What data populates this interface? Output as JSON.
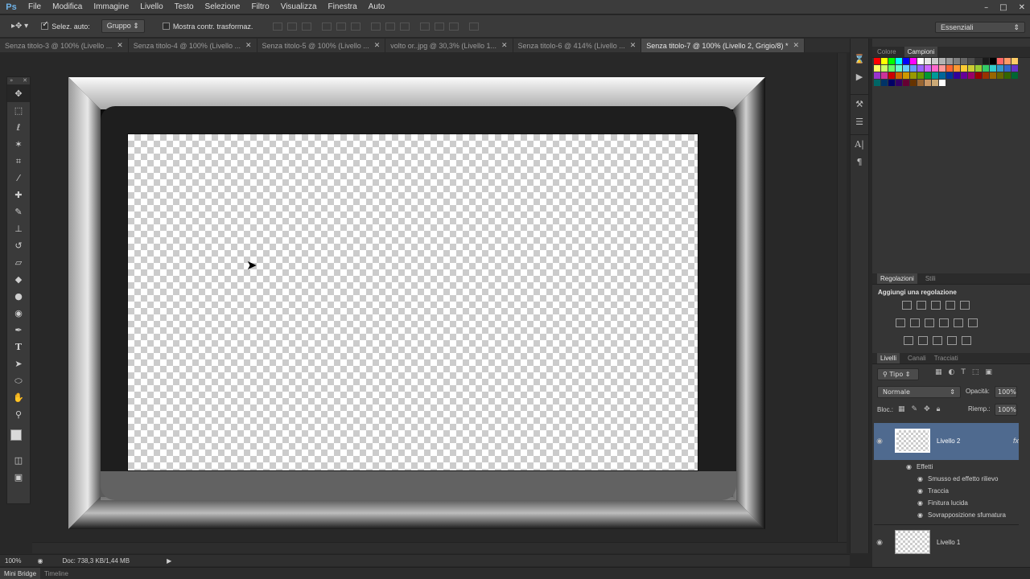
{
  "app": {
    "logo": "Ps"
  },
  "menu": [
    "File",
    "Modifica",
    "Immagine",
    "Livello",
    "Testo",
    "Selezione",
    "Filtro",
    "Visualizza",
    "Finestra",
    "Auto"
  ],
  "window_controls": [
    "–",
    "□",
    "✕"
  ],
  "options": {
    "auto_select_label": "Selez. auto:",
    "auto_select_value": "Gruppo",
    "show_transform_label": "Mostra contr. trasformaz.",
    "workspace": "Essenziali"
  },
  "tabs": [
    {
      "label": "Senza titolo-3 @ 100% (Livello ...",
      "active": false
    },
    {
      "label": "Senza titolo-4 @ 100% (Livello ...",
      "active": false
    },
    {
      "label": "Senza titolo-5 @ 100% (Livello ...",
      "active": false
    },
    {
      "label": "volto or..jpg @ 30,3% (Livello 1...",
      "active": false
    },
    {
      "label": "Senza titolo-6 @ 414% (Livello ...",
      "active": false
    },
    {
      "label": "Senza titolo-7 @ 100% (Livello 2, Grigio/8) *",
      "active": true
    }
  ],
  "tools": [
    "move-tool",
    "marquee-tool",
    "lasso-tool",
    "magic-wand-tool",
    "crop-tool",
    "eyedropper-tool",
    "healing-tool",
    "brush-tool",
    "clone-stamp-tool",
    "history-brush-tool",
    "eraser-tool",
    "paint-bucket-tool",
    "blur-tool",
    "dodge-tool",
    "pen-tool",
    "type-tool",
    "path-selection-tool",
    "ellipse-tool",
    "hand-tool",
    "zoom-tool"
  ],
  "panels": {
    "color_tabs": [
      "Colore",
      "Campioni"
    ],
    "adjust_tabs": [
      "Regolazioni",
      "Stili"
    ],
    "adjust_title": "Aggiungi una regolazione",
    "layer_tabs": [
      "Livelli",
      "Canali",
      "Tracciati"
    ],
    "filter_kind": "Tipo",
    "blend_mode": "Normale",
    "opacity_label": "Opacità:",
    "opacity_value": "100%",
    "lock_label": "Bloc.:",
    "fill_label": "Riemp.:",
    "fill_value": "100%"
  },
  "layers": {
    "layer2": "Livello 2",
    "fx": "fx",
    "effects_label": "Effetti",
    "effects": [
      "Smusso ed effetto rilievo",
      "Traccia",
      "Finitura lucida",
      "Sovrapposizione sfumatura"
    ],
    "layer1": "Livello 1"
  },
  "status": {
    "zoom": "100%",
    "doc": "Doc: 738,3 KB/1,44 MB"
  },
  "bottom_tabs": [
    "Mini Bridge",
    "Timeline"
  ],
  "colors": {
    "swatches": [
      "#ff0000",
      "#ffff00",
      "#00ff00",
      "#00ffff",
      "#0000ff",
      "#ff00ff",
      "#ffffff",
      "#e6e6e6",
      "#cccccc",
      "#b3b3b3",
      "#999999",
      "#808080",
      "#666666",
      "#4d4d4d",
      "#333333",
      "#1a1a1a",
      "#000000",
      "#ff6666",
      "#ff9966",
      "#ffcc66",
      "#ffff66",
      "#ccff66",
      "#66ff66",
      "#66ffcc",
      "#66ccff",
      "#6699ff",
      "#9966ff",
      "#cc66ff",
      "#ff66cc",
      "#ff9999",
      "#ff6633",
      "#ff9933",
      "#ffcc33",
      "#cccc33",
      "#99cc33",
      "#33cc66",
      "#33cccc",
      "#3399cc",
      "#3366cc",
      "#6633cc",
      "#9933cc",
      "#cc3399",
      "#cc0000",
      "#cc6600",
      "#cc9900",
      "#999900",
      "#669900",
      "#009933",
      "#009999",
      "#006699",
      "#003399",
      "#330099",
      "#660099",
      "#990066",
      "#990000",
      "#993300",
      "#996600",
      "#666600",
      "#336600",
      "#006633",
      "#006666",
      "#003366",
      "#000066",
      "#330066",
      "#660033",
      "#663300",
      "#996633",
      "#cc9966",
      "#ccaa77",
      "#ffffff"
    ]
  }
}
